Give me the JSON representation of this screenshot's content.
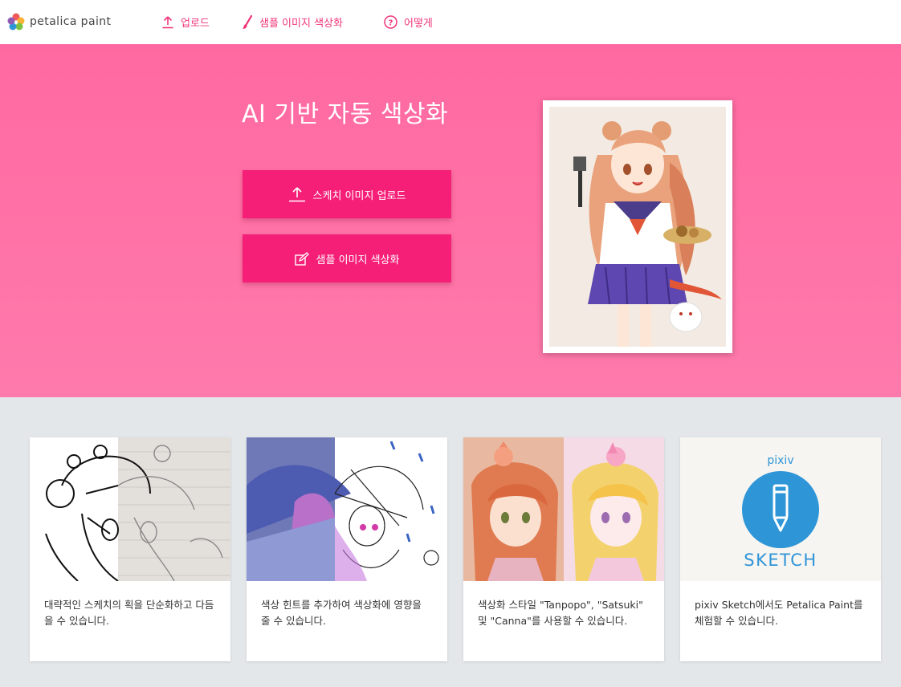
{
  "header": {
    "logo_text": "petalica paint",
    "nav": [
      {
        "label": "업로드",
        "icon": "upload-icon"
      },
      {
        "label": "샘플 이미지 색상화",
        "icon": "brush-icon"
      },
      {
        "label": "어떻게",
        "icon": "question-icon"
      }
    ]
  },
  "hero": {
    "title": "AI 기반 자동 색상화",
    "upload_button": "스케치 이미지 업로드",
    "sample_button": "샘플 이미지 색상화"
  },
  "cards": [
    {
      "text": "대략적인 스케치의 획을 단순화하고 다듬을 수 있습니다."
    },
    {
      "text": "색상 힌트를 추가하여 색상화에 영향을 줄 수 있습니다."
    },
    {
      "text": "색상화 스타일 \"Tanpopo\", \"Satsuki\" 및 \"Canna\"를 사용할 수 있습니다."
    },
    {
      "text": "pixiv Sketch에서도 Petalica Paint를 체험할 수 있습니다.",
      "logo_top": "pixiv",
      "logo_bottom": "SKETCH"
    }
  ],
  "colors": {
    "accent": "#f0367a",
    "hero_bg": "#ff6fa6",
    "button": "#f61f78",
    "page_bg": "#e4e7ea",
    "sketch_blue": "#2e95d7"
  }
}
